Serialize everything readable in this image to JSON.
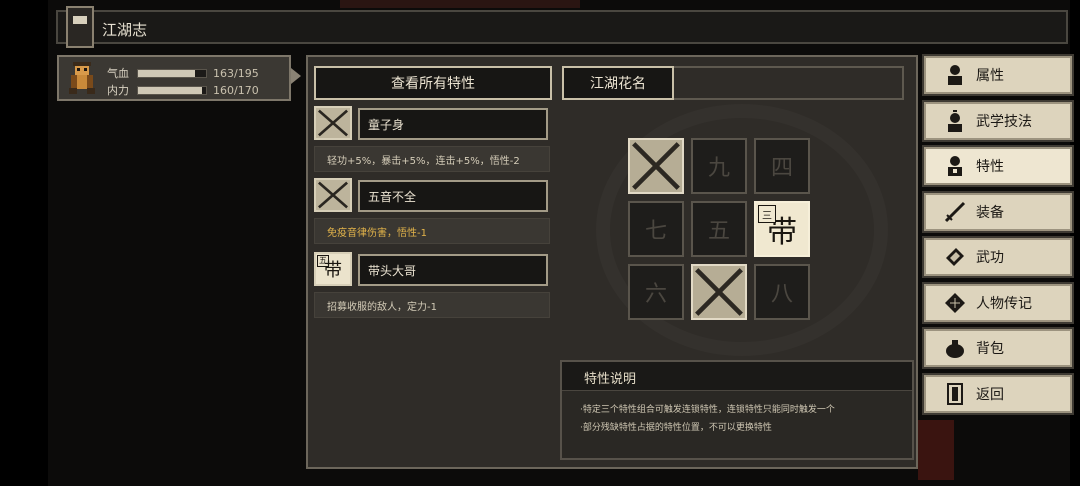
{
  "header": {
    "title": "江湖志"
  },
  "character": {
    "hp_label": "气血",
    "hp_value": "163/195",
    "hp_fraction": 0.836,
    "mp_label": "内力",
    "mp_value": "160/170",
    "mp_fraction": 0.941
  },
  "panel": {
    "view_all_label": "查看所有特性",
    "combo_title": "江湖花名",
    "traits": [
      {
        "icon_char": "",
        "name": "童子身",
        "desc": "轻功+5%，暴击+5%，连击+5%，悟性-2",
        "desc_color": "#d4ccb8"
      },
      {
        "icon_char": "",
        "name": "五音不全",
        "desc": "免疫音律伤害，悟性-1",
        "desc_color": "#e3b44a"
      },
      {
        "icon_char": "带",
        "icon_badge": "五",
        "name": "带头大哥",
        "desc": "招募收服的敌人，定力-1",
        "desc_color": "#d4ccb8"
      }
    ],
    "grid": [
      {
        "char": "",
        "state": "filled-cross"
      },
      {
        "char": "九",
        "state": "empty"
      },
      {
        "char": "四",
        "state": "empty"
      },
      {
        "char": "七",
        "state": "empty"
      },
      {
        "char": "五",
        "state": "empty"
      },
      {
        "char": "带",
        "badge": "三",
        "state": "bright"
      },
      {
        "char": "六",
        "state": "empty"
      },
      {
        "char": "",
        "state": "filled-cross"
      },
      {
        "char": "八",
        "state": "empty"
      }
    ],
    "description": {
      "title": "特性说明",
      "lines": [
        "·特定三个特性组合可触发连锁特性，连锁特性只能同时触发一个",
        "·部分残缺特性占据的特性位置，不可以更换特性"
      ]
    }
  },
  "menu": [
    {
      "label": "属性",
      "icon": "person-icon"
    },
    {
      "label": "武学技法",
      "icon": "thinking-person-icon"
    },
    {
      "label": "特性",
      "icon": "person-trait-icon",
      "active": true
    },
    {
      "label": "装备",
      "icon": "sword-icon"
    },
    {
      "label": "武功",
      "icon": "book-icon"
    },
    {
      "label": "人物传记",
      "icon": "diamond-icon"
    },
    {
      "label": "背包",
      "icon": "bag-icon"
    },
    {
      "label": "返回",
      "icon": "door-icon"
    }
  ]
}
